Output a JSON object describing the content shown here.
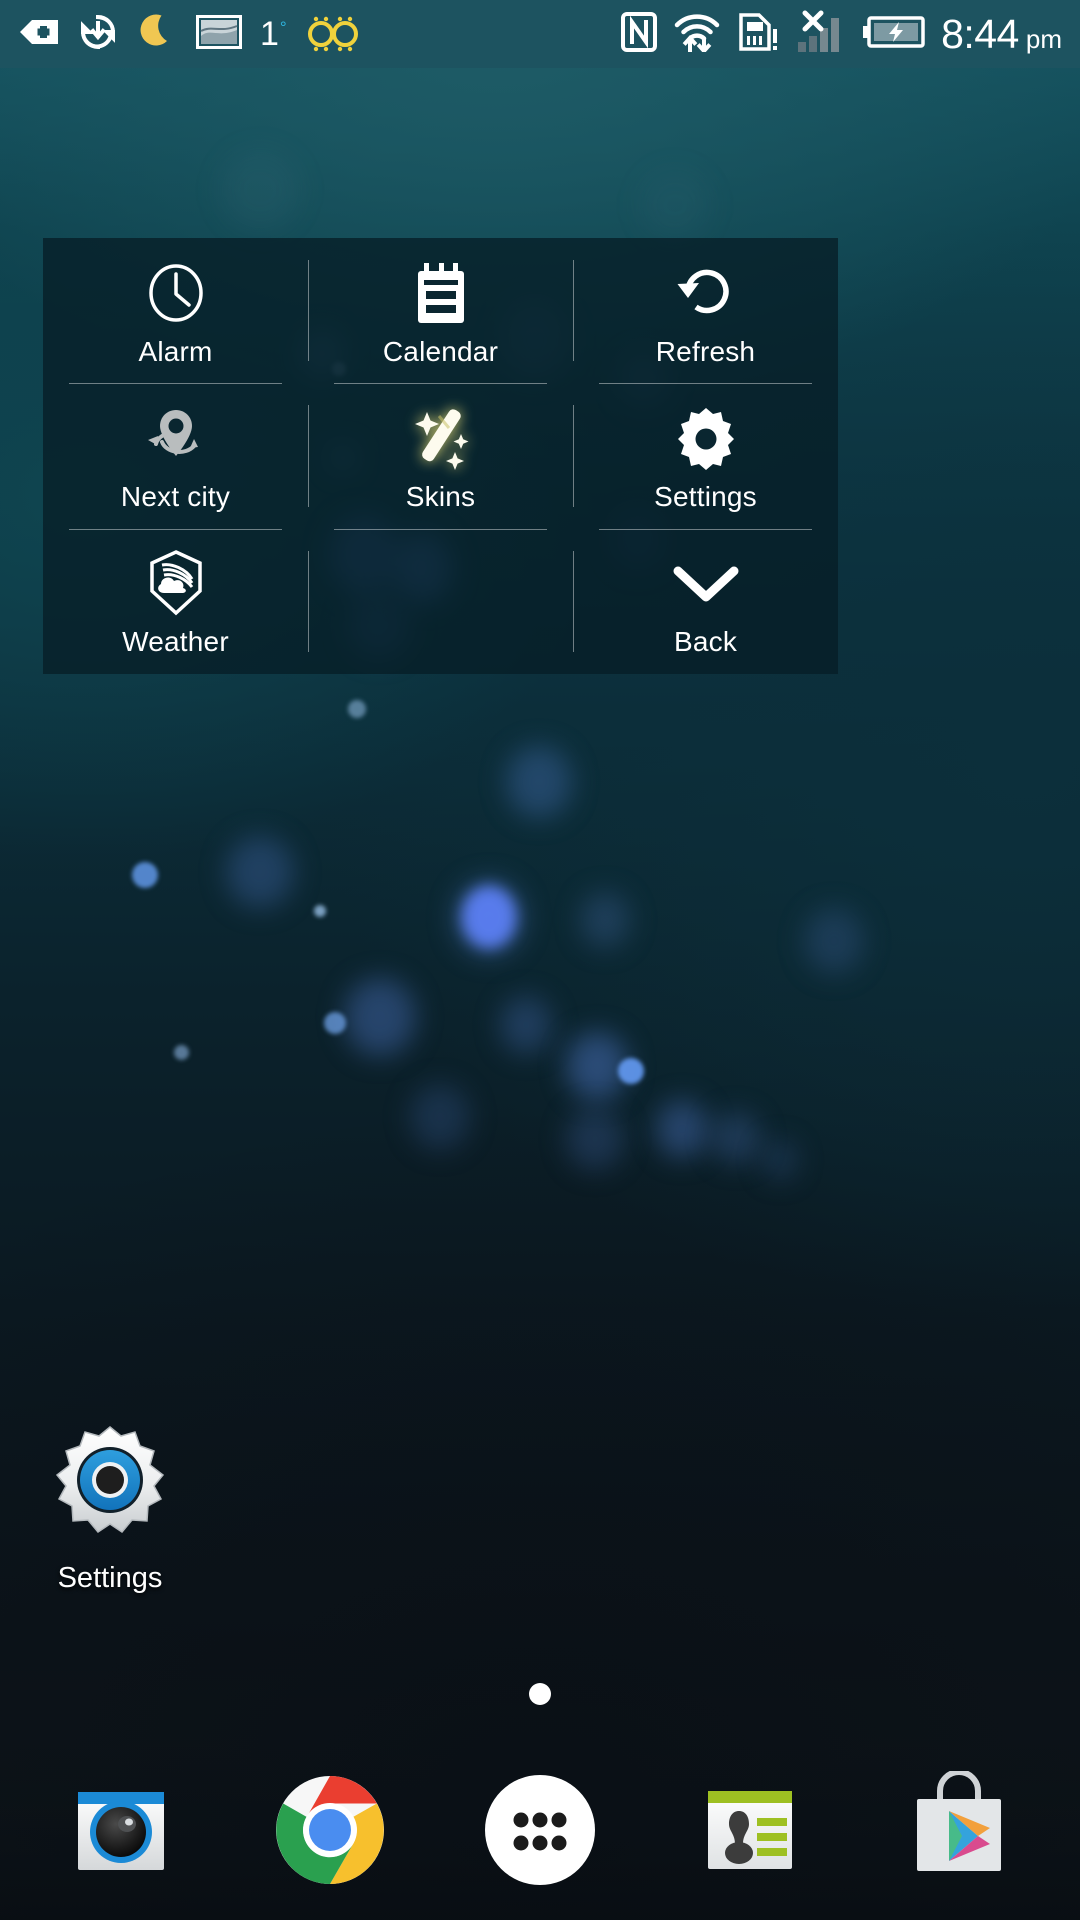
{
  "status_bar": {
    "background_color": "#1d5360",
    "left_icons": [
      {
        "name": "medical-plus-badge-icon",
        "label": "Health app notification"
      },
      {
        "name": "sync-download-icon",
        "label": "Sync active"
      },
      {
        "name": "moon-icon",
        "label": "Do not disturb / night mode"
      },
      {
        "name": "screenshot-image-icon",
        "label": "Screenshot captured"
      },
      {
        "name": "temperature-icon",
        "label": "1",
        "degree": "°",
        "degree_color": "#2fb6e0"
      },
      {
        "name": "glasses-icon",
        "label": "Reading mode",
        "color": "#f0d23c"
      }
    ],
    "right_icons": [
      {
        "name": "nfc-icon",
        "label": "NFC enabled"
      },
      {
        "name": "wifi-transfer-icon",
        "label": "Wi-Fi with data transfer"
      },
      {
        "name": "sim-card-alert-icon",
        "label": "SIM card problem"
      },
      {
        "name": "signal-no-service-icon",
        "label": "No cellular service"
      },
      {
        "name": "battery-charging-icon",
        "label": "Battery charging"
      }
    ],
    "clock": {
      "time": "8:44",
      "meridiem": "pm"
    }
  },
  "widget_panel": {
    "background_color": "#061e26",
    "cells": [
      {
        "id": "alarm",
        "label": "Alarm",
        "icon": "clock-icon"
      },
      {
        "id": "calendar",
        "label": "Calendar",
        "icon": "calendar-icon"
      },
      {
        "id": "refresh",
        "label": "Refresh",
        "icon": "refresh-icon"
      },
      {
        "id": "next-city",
        "label": "Next city",
        "icon": "location-pin-rotate-icon",
        "icon_color": "#b9bdbe"
      },
      {
        "id": "skins",
        "label": "Skins",
        "icon": "magic-wand-sparkle-icon",
        "icon_color": "#fbf6cf"
      },
      {
        "id": "settings",
        "label": "Settings",
        "icon": "gear-icon"
      },
      {
        "id": "weather",
        "label": "Weather",
        "icon": "weather-cloud-icon"
      },
      {
        "id": "blank",
        "label": "",
        "icon": "none"
      },
      {
        "id": "back",
        "label": "Back",
        "icon": "chevron-down-icon"
      }
    ]
  },
  "home_icons": [
    {
      "id": "settings",
      "label": "Settings",
      "icon": "settings-gear-app-icon"
    }
  ],
  "page_indicator": {
    "pages": 1,
    "current": 1
  },
  "dock": {
    "items": [
      {
        "id": "camera",
        "label": "Camera",
        "icon": "camera-app-icon"
      },
      {
        "id": "chrome",
        "label": "Chrome",
        "icon": "chrome-app-icon"
      },
      {
        "id": "drawer",
        "label": "Apps",
        "icon": "app-drawer-icon"
      },
      {
        "id": "contacts",
        "label": "Contacts",
        "icon": "contacts-app-icon"
      },
      {
        "id": "play",
        "label": "Play Store",
        "icon": "play-store-app-icon"
      }
    ]
  },
  "wallpaper": {
    "description": "Dark teal-to-navy gradient with blue bokeh circles",
    "top_color": "#175764",
    "bottom_color": "#101619"
  }
}
